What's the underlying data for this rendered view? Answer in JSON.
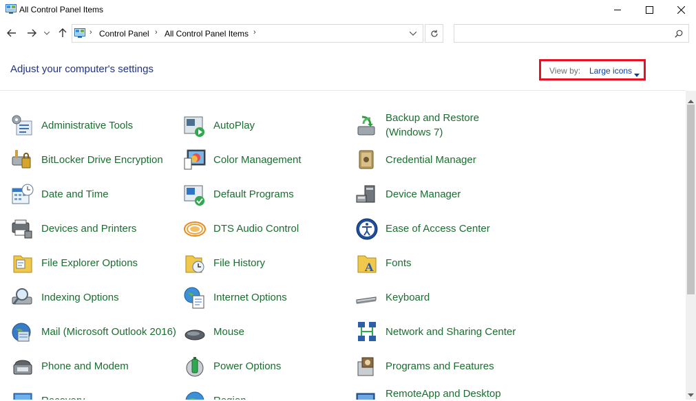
{
  "window": {
    "title": "All Control Panel Items"
  },
  "address": {
    "crumbs": [
      "Control Panel",
      "All Control Panel Items"
    ],
    "search_placeholder": ""
  },
  "header": {
    "title": "Adjust your computer's settings",
    "view_by_label": "View by:",
    "view_by_value": "Large icons"
  },
  "items": [
    {
      "label": "Administrative Tools",
      "icon": "admin-tools-icon"
    },
    {
      "label": "AutoPlay",
      "icon": "autoplay-icon"
    },
    {
      "label": "Backup and Restore (Windows 7)",
      "icon": "backup-restore-icon"
    },
    {
      "label": "BitLocker Drive Encryption",
      "icon": "bitlocker-icon"
    },
    {
      "label": "Color Management",
      "icon": "color-management-icon"
    },
    {
      "label": "Credential Manager",
      "icon": "credential-manager-icon"
    },
    {
      "label": "Date and Time",
      "icon": "date-time-icon"
    },
    {
      "label": "Default Programs",
      "icon": "default-programs-icon"
    },
    {
      "label": "Device Manager",
      "icon": "device-manager-icon"
    },
    {
      "label": "Devices and Printers",
      "icon": "devices-printers-icon"
    },
    {
      "label": "DTS Audio Control",
      "icon": "dts-audio-icon"
    },
    {
      "label": "Ease of Access Center",
      "icon": "ease-of-access-icon"
    },
    {
      "label": "File Explorer Options",
      "icon": "file-explorer-options-icon"
    },
    {
      "label": "File History",
      "icon": "file-history-icon"
    },
    {
      "label": "Fonts",
      "icon": "fonts-icon"
    },
    {
      "label": "Indexing Options",
      "icon": "indexing-options-icon"
    },
    {
      "label": "Internet Options",
      "icon": "internet-options-icon"
    },
    {
      "label": "Keyboard",
      "icon": "keyboard-icon"
    },
    {
      "label": "Mail (Microsoft Outlook 2016)",
      "icon": "mail-icon"
    },
    {
      "label": "Mouse",
      "icon": "mouse-icon"
    },
    {
      "label": "Network and Sharing Center",
      "icon": "network-sharing-icon"
    },
    {
      "label": "Phone and Modem",
      "icon": "phone-modem-icon"
    },
    {
      "label": "Power Options",
      "icon": "power-options-icon"
    },
    {
      "label": "Programs and Features",
      "icon": "programs-features-icon"
    },
    {
      "label": "Recovery",
      "icon": "recovery-icon"
    },
    {
      "label": "Region",
      "icon": "region-icon"
    },
    {
      "label": "RemoteApp and Desktop",
      "icon": "remoteapp-icon"
    }
  ],
  "colors": {
    "link_green": "#1a6e2f",
    "heading_blue": "#1e3287",
    "highlight_red": "#e81123"
  }
}
